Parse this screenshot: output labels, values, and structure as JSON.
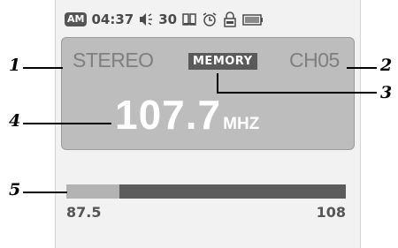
{
  "status_bar": {
    "am_badge": "AM",
    "time": "04:37",
    "volume": "30",
    "icons": [
      "speaker-icon",
      "book-icon",
      "alarm-clock-icon",
      "lock-icon",
      "battery-icon"
    ]
  },
  "radio": {
    "audio_mode": "STEREO",
    "preset_badge": "MEMORY",
    "channel": "CH05",
    "frequency": "107.7",
    "unit": "MHZ"
  },
  "tuner": {
    "min_label": "87.5",
    "max_label": "108",
    "fill_fraction": 0.19
  },
  "callouts": [
    "1",
    "2",
    "3",
    "4",
    "5"
  ],
  "colors": {
    "screen_bg": "#f2f2f2",
    "panel_bg": "#bdbdbd",
    "bar_track": "#5c5c5c",
    "bar_fill": "#b3b3b3"
  }
}
